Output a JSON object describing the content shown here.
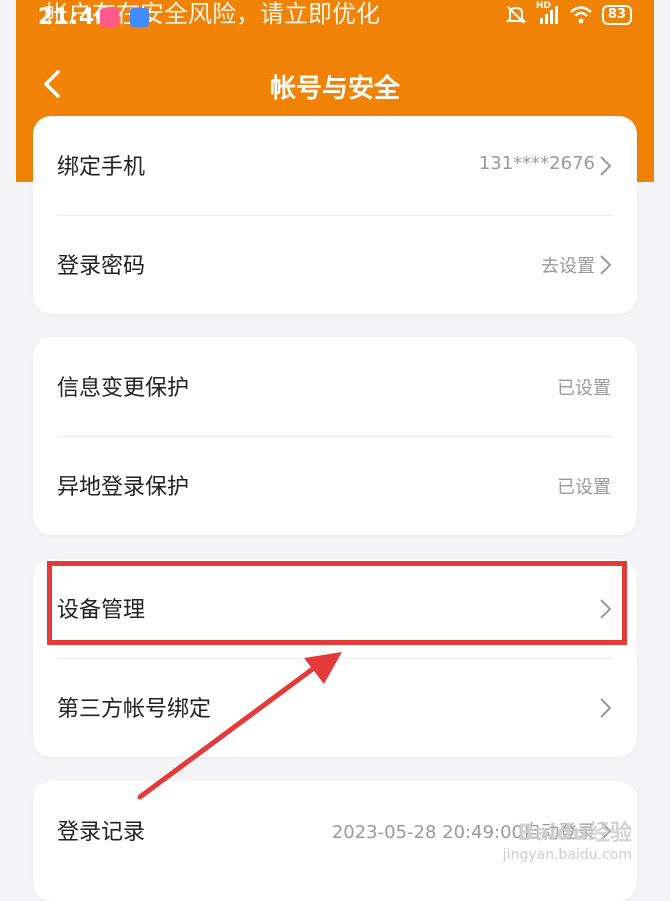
{
  "status_bar": {
    "time": "21:46",
    "notice": "帐户存在安全风险，请立即优化",
    "signal_label": "HD",
    "battery": "83"
  },
  "nav": {
    "title": "帐号与安全",
    "back_icon": "chevron-left-icon"
  },
  "groups": [
    {
      "rows": [
        {
          "label": "绑定手机",
          "value": "131****2676",
          "chevron": true
        },
        {
          "label": "登录密码",
          "value": "去设置",
          "chevron": true
        }
      ]
    },
    {
      "rows": [
        {
          "label": "信息变更保护",
          "value": "已设置",
          "chevron": false
        },
        {
          "label": "异地登录保护",
          "value": "已设置",
          "chevron": false
        }
      ]
    },
    {
      "rows": [
        {
          "label": "设备管理",
          "value": "",
          "chevron": true
        },
        {
          "label": "第三方帐号绑定",
          "value": "",
          "chevron": true
        }
      ]
    },
    {
      "rows": [
        {
          "label": "登录记录",
          "value": "2023-05-28 20:49:00自动登录",
          "chevron": true
        }
      ]
    }
  ],
  "annotation": {
    "color": "#e53a3a",
    "highlighted_row": "设备管理"
  },
  "watermark": {
    "main": "Baidu经验",
    "sub": "jingyan.baidu.com"
  },
  "colors": {
    "header": "#f08306",
    "background": "#f4f4f6"
  }
}
